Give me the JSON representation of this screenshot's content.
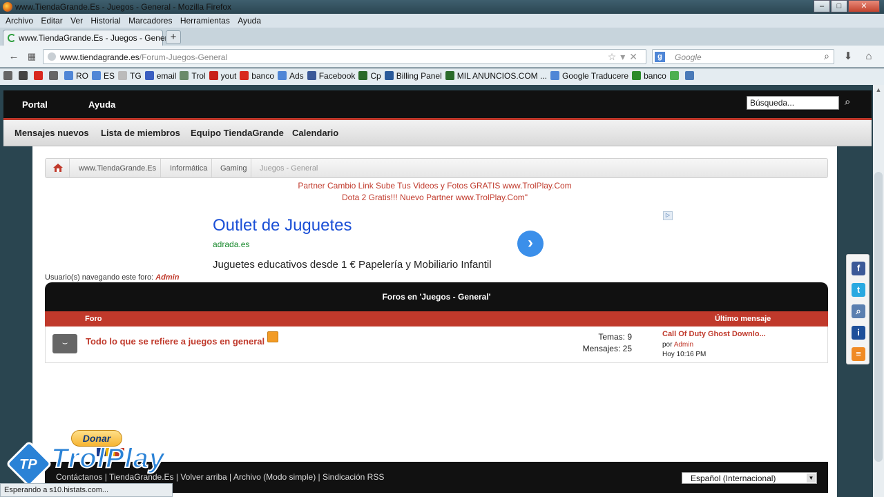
{
  "window": {
    "title": "www.TiendaGrande.Es - Juegos - General - Mozilla Firefox",
    "controls": [
      "–",
      "□",
      "✕"
    ]
  },
  "menu": [
    "Archivo",
    "Editar",
    "Ver",
    "Historial",
    "Marcadores",
    "Herramientas",
    "Ayuda"
  ],
  "tab": {
    "label": "www.TiendaGrande.Es - Juegos - General",
    "new_tab": "+"
  },
  "nav": {
    "back": "←",
    "url_domain": "www.tiendagrande.es",
    "url_path": "/Forum-Juegos-General",
    "url_icons": "☆▾✕",
    "search_engine": "g",
    "search_placeholder": "Google",
    "search_icon": "⌕",
    "download": "⬇",
    "home": "⌂"
  },
  "bookmarks": [
    {
      "label": "",
      "color": "#666"
    },
    {
      "label": "",
      "color": "#444"
    },
    {
      "label": "",
      "color": "#d8281e"
    },
    {
      "label": "",
      "color": "#666"
    },
    {
      "label": "RO",
      "color": "#4f86d6"
    },
    {
      "label": "ES",
      "color": "#4f86d6"
    },
    {
      "label": "TG",
      "color": "#bbb"
    },
    {
      "label": "email",
      "color": "#3a5ec0"
    },
    {
      "label": "Trol",
      "color": "#6a8a6a"
    },
    {
      "label": "yout",
      "color": "#c8201a"
    },
    {
      "label": "banco",
      "color": "#d8281e"
    },
    {
      "label": "Ads",
      "color": "#4f86d6"
    },
    {
      "label": "Facebook",
      "color": "#3b5998"
    },
    {
      "label": "Cp",
      "color": "#2a6a2a"
    },
    {
      "label": "Billing Panel",
      "color": "#2a5a9a"
    },
    {
      "label": "MIL ANUNCIOS.COM ...",
      "color": "#2a6a2a"
    },
    {
      "label": "Google Traducere",
      "color": "#4f86d6"
    },
    {
      "label": "banco",
      "color": "#2a8a2a"
    },
    {
      "label": "",
      "color": "#4caf50"
    },
    {
      "label": "",
      "color": "#4a7ab8"
    }
  ],
  "site": {
    "topnav": [
      "Portal",
      "Ayuda"
    ],
    "search_value": "Búsqueda...",
    "subnav": [
      "Mensajes nuevos",
      "Lista de miembros",
      "Equipo TiendaGrande",
      "Calendario"
    ],
    "breadcrumbs": [
      "www.TiendaGrande.Es",
      "Informática",
      "Gaming",
      "Juegos - General"
    ],
    "partner_line1": "Partner Cambio Link Sube Tus Videos y Fotos GRATIS www.TrolPlay.Com",
    "partner_line2": "Dota 2 Gratis!!! Nuevo Partner www.TrolPlay.Com\"",
    "ad": {
      "title": "Outlet de Juguetes",
      "url": "adrada.es",
      "description": "Juguetes educativos desde 1 € Papelería y Mobiliario Infantil",
      "go": "›",
      "choices": "▷"
    },
    "browsing_label": "Usuario(s) navegando este foro:",
    "browsing_user": "Admin",
    "forum": {
      "header": "Foros en 'Juegos - General'",
      "col_forum": "Foro",
      "col_last": "Último mensaje",
      "row": {
        "title": "Todo lo que se refiere a juegos en general",
        "temas": "Temas: 9",
        "mensajes": "Mensajes: 25",
        "last_title": "Call Of Duty Ghost Downlo...",
        "last_by_label": "por",
        "last_by_user": "Admin",
        "last_time": "Hoy 10:16 PM"
      }
    },
    "donate": "Donar",
    "footer_links": "Contáctanos | TiendaGrande.Es | Volver arriba | Archivo (Modo simple) | Sindicación RSS",
    "language": "Español (Internacional)",
    "logo_tp": "TP",
    "logo_name": "TrolPlay"
  },
  "social": [
    {
      "label": "f",
      "color": "#3b5998"
    },
    {
      "label": "t",
      "color": "#29a9e1"
    },
    {
      "label": "⌕",
      "color": "#5a7fb0"
    },
    {
      "label": "i",
      "color": "#1d4f9a"
    },
    {
      "label": "≡",
      "color": "#f08a24"
    }
  ],
  "status": "Esperando a s10.histats.com..."
}
